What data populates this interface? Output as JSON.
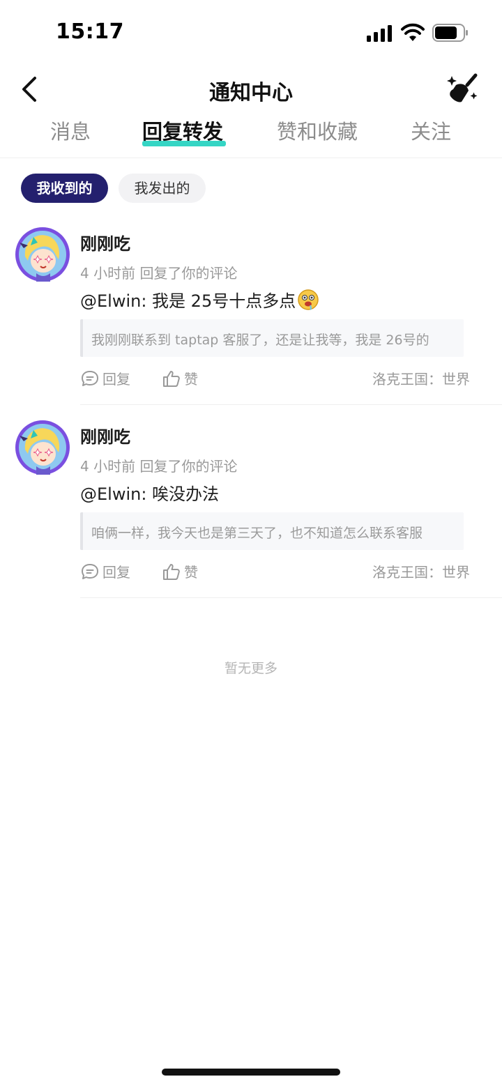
{
  "status_bar": {
    "time": "15:17",
    "icons": [
      "signal-icon",
      "wifi-icon",
      "battery-icon"
    ]
  },
  "nav": {
    "title": "通知中心",
    "back_icon": "back-icon",
    "clear_icon": "broom-icon"
  },
  "tabs": [
    {
      "label": "消息",
      "active": false
    },
    {
      "label": "回复转发",
      "active": true
    },
    {
      "label": "赞和收藏",
      "active": false
    },
    {
      "label": "关注",
      "active": false
    }
  ],
  "filters": {
    "received": "我收到的",
    "sent": "我发出的"
  },
  "items": [
    {
      "user": "刚刚吃",
      "meta": "4 小时前 回复了你的评论",
      "body": "@Elwin: 我是 25号十点多点",
      "quote": "我刚刚联系到 taptap 客服了，还是让我等，我是 26号的",
      "reply_label": "回复",
      "like_label": "赞",
      "source": "洛克王国：世界"
    },
    {
      "user": "刚刚吃",
      "meta": "4 小时前 回复了你的评论",
      "body": "@Elwin: 唉没办法",
      "quote": "咱俩一样，我今天也是第三天了，也不知道怎么联系客服",
      "reply_label": "回复",
      "like_label": "赞",
      "source": "洛克王国：世界"
    }
  ],
  "footer": {
    "end_text": "暂无更多"
  },
  "colors": {
    "accent": "#35d5c4",
    "pill_active": "#24206e",
    "avatar_ring": "#7a4fe0"
  }
}
